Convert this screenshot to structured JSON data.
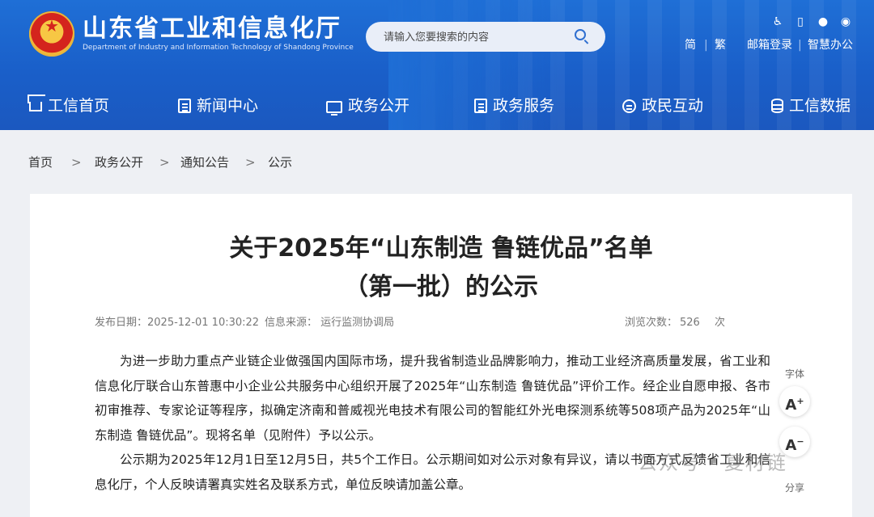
{
  "header": {
    "site_title": "山东省工业和信息化厅",
    "site_subtitle": "Department of Industry and Information Technology of Shandong Province",
    "search_placeholder": "请输入您要搜索的内容",
    "links": {
      "simplified": "简",
      "separator": "|",
      "traditional": "繁",
      "mail_login": "邮箱登录",
      "smart_office": "智慧办公"
    },
    "icons": [
      "accessibility-icon",
      "mobile-icon",
      "wechat-icon",
      "weibo-icon"
    ]
  },
  "nav": {
    "items": [
      {
        "label": "工信首页",
        "icon": "home-icon"
      },
      {
        "label": "新闻中心",
        "icon": "news-icon"
      },
      {
        "label": "政务公开",
        "icon": "screen-icon"
      },
      {
        "label": "政务服务",
        "icon": "service-icon"
      },
      {
        "label": "政民互动",
        "icon": "interaction-icon"
      },
      {
        "label": "工信数据",
        "icon": "database-icon"
      }
    ]
  },
  "breadcrumb": {
    "items": [
      "首页",
      "政务公开",
      "通知公告",
      "公示"
    ],
    "separator": ">"
  },
  "article": {
    "title_line1": "关于2025年“山东制造 鲁链优品”名单",
    "title_line2": "（第一批）的公示",
    "publish_date": "发布日期：2025-12-01 10:30:22",
    "source": "信息来源：  运行监测协调局",
    "views_label": "浏览次数：",
    "views_count": "526",
    "views_unit": "次",
    "paragraphs": [
      "为进一步助力重点产业链企业做强国内国际市场，提升我省制造业品牌影响力，推动工业经济高质量发展，省工业和信息化厅联合山东普惠中小企业公共服务中心组织开展了2025年“山东制造 鲁链优品”评价工作。经企业自愿申报、各市初审推荐、专家论证等程序，拟确定济南和普威视光电技术有限公司的智能红外光电探测系统等508项产品为2025年“山东制造 鲁链优品”。现将名单（见附件）予以公示。",
      "公示期为2025年12月1日至12月5日，共5个工作日。公示期间如对公示对象有异议，请以书面方式反馈省工业和信息化厅，个人反映请署真实姓名及联系方式，单位反映请加盖公章。"
    ]
  },
  "tools": {
    "font_label": "字体",
    "enlarge": "A",
    "shrink": "A",
    "share_label": "分享"
  },
  "watermark": "公众号 · 复材链",
  "colors": {
    "header_blue": "#1f6fd6",
    "background": "#eef0f4"
  }
}
